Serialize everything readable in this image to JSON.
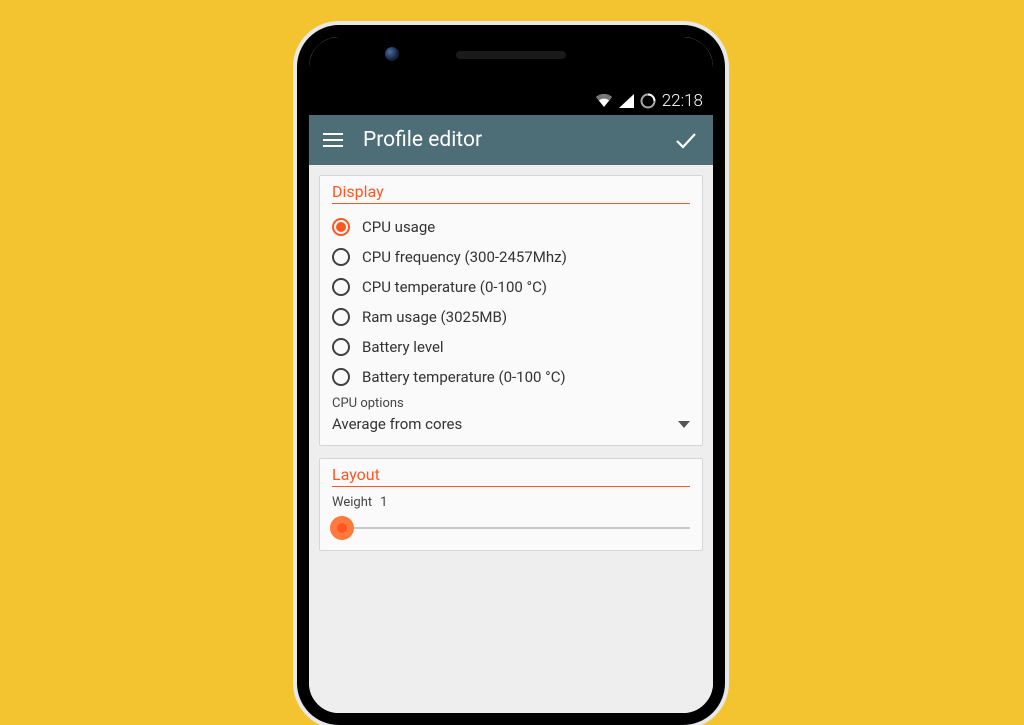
{
  "status": {
    "time": "22:18"
  },
  "appbar": {
    "title": "Profile editor"
  },
  "display": {
    "section_title": "Display",
    "options": [
      "CPU usage",
      "CPU frequency (300-2457Mhz)",
      "CPU temperature (0-100 °C)",
      "Ram usage (3025MB)",
      "Battery level",
      "Battery temperature (0-100 °C)"
    ],
    "selected_index": 0,
    "cpu_options_label": "CPU options",
    "cpu_options_value": "Average from cores"
  },
  "layout": {
    "section_title": "Layout",
    "weight_label": "Weight",
    "weight_value": "1"
  }
}
